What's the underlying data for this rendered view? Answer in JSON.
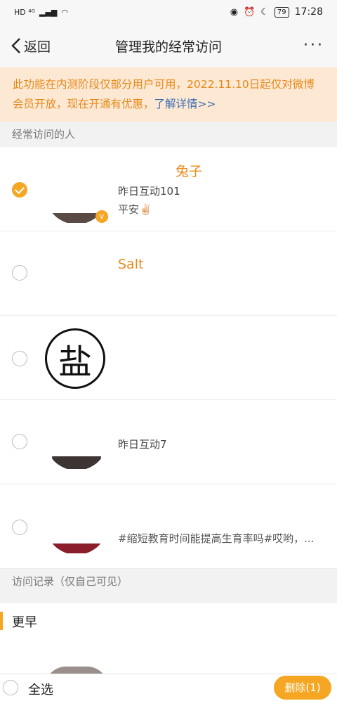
{
  "statusbar": {
    "left": "HD ⁴ᴳ",
    "battery": "79",
    "time": "17:28"
  },
  "nav": {
    "back_label": "返回",
    "title": "管理我的经常访问",
    "more": "···"
  },
  "notice": {
    "text": "此功能在内测阶段仅部分用户可用，2022.11.10日起仅对微博会员开放，现在开通有优惠，",
    "link": "了解详情>>"
  },
  "sections": {
    "frequent": "经常访问的人",
    "history": "访问记录（仅自己可见）"
  },
  "people": [
    {
      "name": "兔子",
      "line1": "昨日互动101",
      "line2": "平安✌🏻",
      "checked": true
    },
    {
      "name": "Salt",
      "line1": "",
      "line2": "",
      "checked": false
    },
    {
      "name": "",
      "seal": "盐",
      "checked": false
    },
    {
      "name": "",
      "line1": "昨日互动7",
      "checked": false
    },
    {
      "name": "",
      "line2": "#缩短教育时间能提高生育率吗#哎哟，...",
      "checked": false
    }
  ],
  "history": {
    "group_label": "更早"
  },
  "bottom": {
    "select_all": "全选",
    "delete_label": "删除(1)"
  }
}
